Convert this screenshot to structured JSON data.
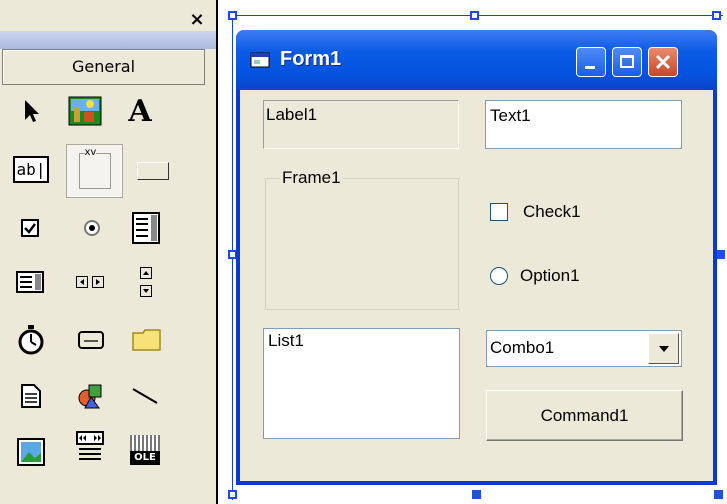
{
  "toolbox": {
    "close_label": "×",
    "tab_label": "General",
    "tools": [
      {
        "name": "pointer-tool",
        "icon": "arrow-pointer-icon"
      },
      {
        "name": "picturebox-tool",
        "icon": "picturebox-icon"
      },
      {
        "name": "label-tool",
        "icon": "label-A-icon",
        "glyph": "A"
      },
      {
        "name": "textbox-tool",
        "icon": "textbox-icon",
        "glyph": "ab|"
      },
      {
        "name": "frame-tool",
        "icon": "frame-icon",
        "glyph": "xv"
      },
      {
        "name": "commandbutton-tool",
        "icon": "command-button-icon"
      },
      {
        "name": "checkbox-tool",
        "icon": "checkbox-icon"
      },
      {
        "name": "optionbutton-tool",
        "icon": "option-button-icon"
      },
      {
        "name": "combobox-tool",
        "icon": "combobox-icon"
      },
      {
        "name": "listbox-tool",
        "icon": "listbox-icon"
      },
      {
        "name": "hscrollbar-tool",
        "icon": "hscrollbar-icon"
      },
      {
        "name": "vscrollbar-tool",
        "icon": "vscrollbar-icon"
      },
      {
        "name": "timer-tool",
        "icon": "timer-stopwatch-icon"
      },
      {
        "name": "drivelistbox-tool",
        "icon": "drive-icon"
      },
      {
        "name": "dirlistbox-tool",
        "icon": "folder-icon"
      },
      {
        "name": "filelistbox-tool",
        "icon": "file-icon"
      },
      {
        "name": "shape-tool",
        "icon": "shape-icon"
      },
      {
        "name": "line-tool",
        "icon": "line-icon"
      },
      {
        "name": "image-tool",
        "icon": "image-icon"
      },
      {
        "name": "data-tool",
        "icon": "data-control-icon"
      },
      {
        "name": "ole-tool",
        "icon": "ole-icon",
        "glyph": "OLE"
      }
    ]
  },
  "form": {
    "title": "Form1",
    "controls": {
      "label1": "Label1",
      "text1": "Text1",
      "frame1": "Frame1",
      "check1": "Check1",
      "option1": "Option1",
      "list1": "List1",
      "combo1": "Combo1",
      "command1": "Command1"
    }
  },
  "colors": {
    "caption_blue": "#0454e1",
    "window_border": "#0a39d6",
    "face": "#ece9d8",
    "close_red": "#c6472a",
    "handle_blue": "#1f46ff"
  }
}
